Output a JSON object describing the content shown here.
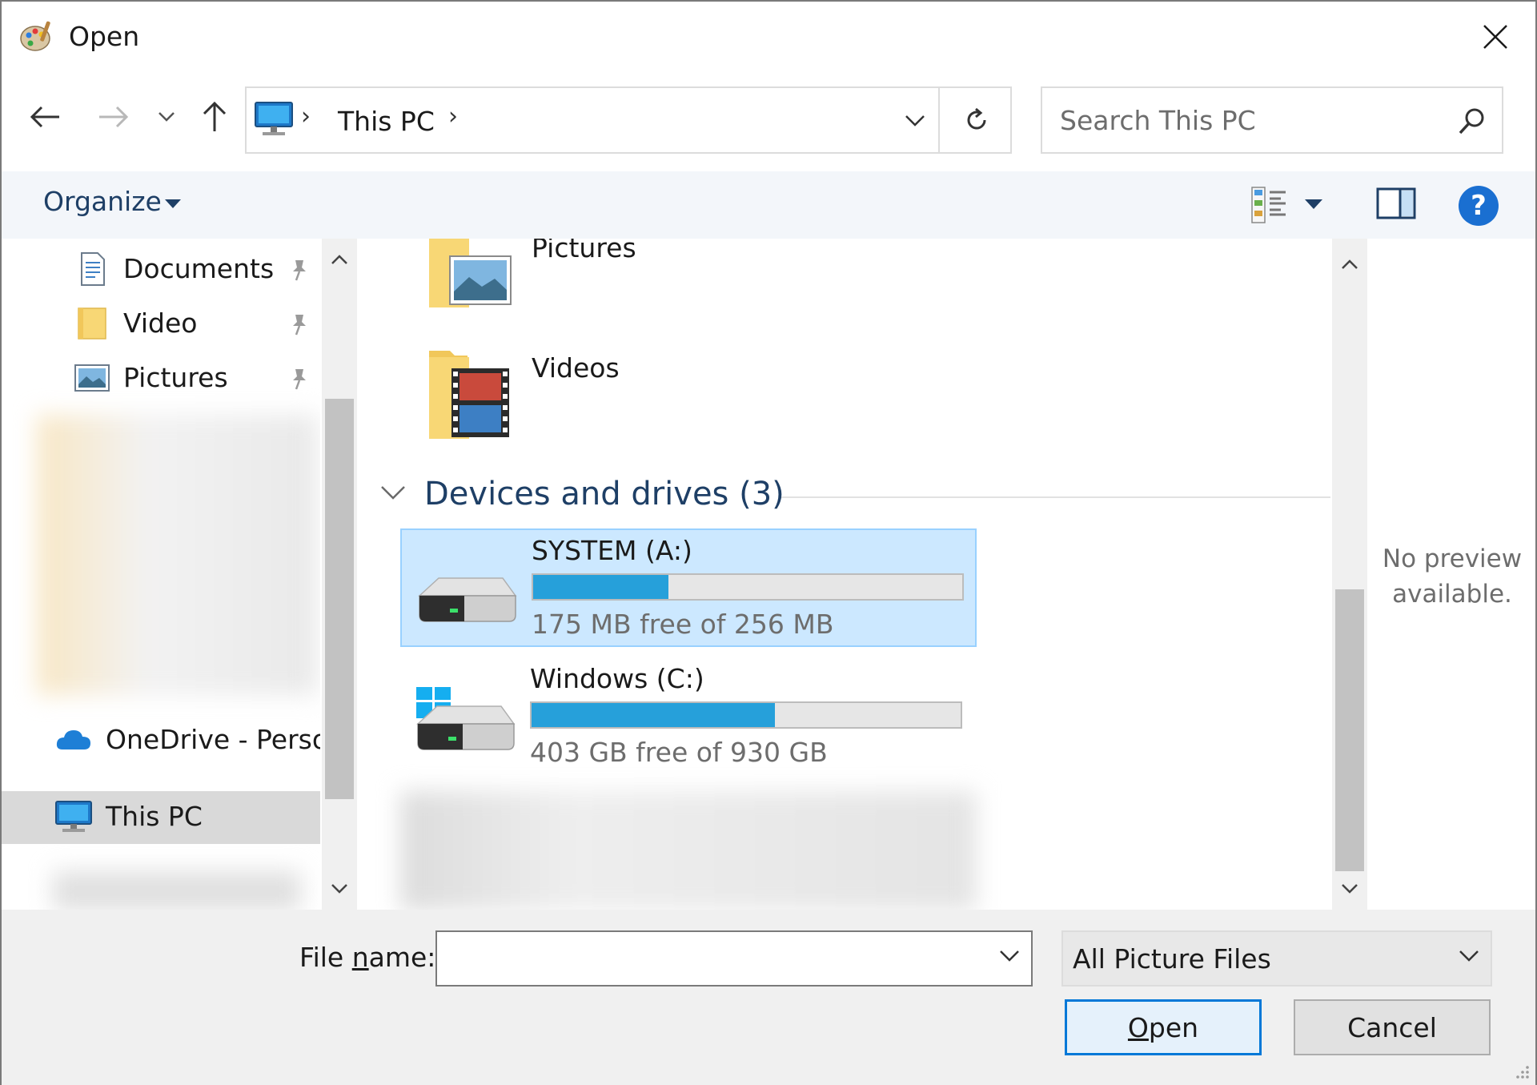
{
  "window": {
    "title": "Open",
    "app_icon": "paint-palette-icon"
  },
  "nav": {
    "back_icon": "arrow-left-icon",
    "forward_icon": "arrow-right-icon",
    "recent_icon": "chevron-down-icon",
    "up_icon": "arrow-up-icon",
    "address": {
      "location": "This PC",
      "icon": "computer-icon"
    },
    "search": {
      "placeholder": "Search This PC"
    }
  },
  "commandbar": {
    "organize_label": "Organize",
    "view_icon": "details-view-icon",
    "preview_icon": "preview-pane-icon",
    "help_label": "?"
  },
  "navpane": {
    "items": [
      {
        "label": "Documents",
        "icon": "documents-icon",
        "pinned": true
      },
      {
        "label": "Video",
        "icon": "folder-icon",
        "pinned": true
      },
      {
        "label": "Pictures",
        "icon": "pictures-icon",
        "pinned": true
      },
      {
        "label": "OneDrive - Persor",
        "icon": "onedrive-cloud-icon"
      },
      {
        "label": "This PC",
        "icon": "computer-icon",
        "selected": true
      }
    ]
  },
  "content": {
    "folders": [
      {
        "label": "Pictures",
        "icon": "pictures-folder-icon"
      },
      {
        "label": "Videos",
        "icon": "videos-folder-icon"
      }
    ],
    "group": {
      "title": "Devices and drives (3)"
    },
    "drives": [
      {
        "name": "SYSTEM (A:)",
        "free_text": "175 MB free of 256 MB",
        "used_fraction": 0.316,
        "selected": true,
        "icon": "hard-drive-icon"
      },
      {
        "name": "Windows (C:)",
        "free_text": "403 GB free of 930 GB",
        "used_fraction": 0.567,
        "selected": false,
        "icon": "windows-drive-icon"
      }
    ]
  },
  "preview": {
    "text": "No preview available."
  },
  "bottom": {
    "filename_label_pre": "File ",
    "filename_label_u": "n",
    "filename_label_post": "ame:",
    "filename_value": "",
    "filter_value": "All Picture Files",
    "open_u": "O",
    "open_rest": "pen",
    "cancel_label": "Cancel"
  },
  "colors": {
    "selection_bg": "#cce8ff",
    "drive_bar": "#26a0da",
    "accent": "#0078d7",
    "header_text": "#1e3f66"
  }
}
